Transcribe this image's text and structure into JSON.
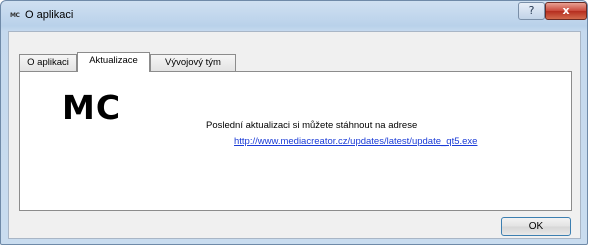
{
  "window": {
    "icon_text": "MC",
    "title": "O aplikaci",
    "help_glyph": "?",
    "close_glyph": "x"
  },
  "tabs": [
    {
      "label": "O aplikaci",
      "active": false
    },
    {
      "label": "Aktualizace",
      "active": true
    },
    {
      "label": "Vývojový tým",
      "active": false
    }
  ],
  "panel": {
    "logo": "MC",
    "message": "Poslední aktualizaci si můžete stáhnout na adrese",
    "link": "http://www.mediacreator.cz/updates/latest/update_qt5.exe"
  },
  "buttons": {
    "ok_label": "OK"
  }
}
